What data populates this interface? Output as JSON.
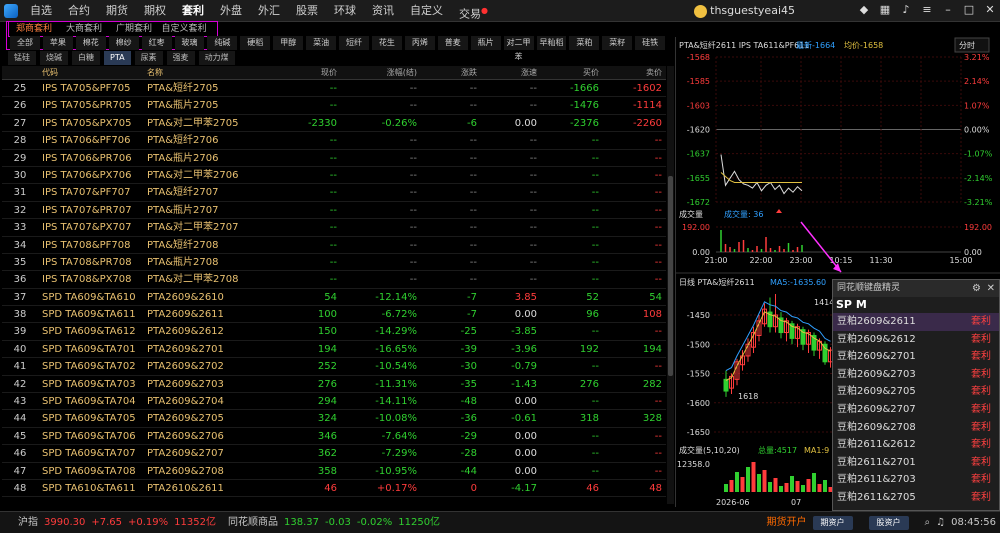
{
  "nav": {
    "items": [
      "自选",
      "合约",
      "期货",
      "期权",
      "套利",
      "外盘",
      "外汇",
      "股票",
      "环球",
      "资讯",
      "自定义",
      "交易"
    ],
    "active": "套利",
    "user": "thsguestyeai45"
  },
  "market_tabs": [
    "郑商套利",
    "大商套利",
    "广期套利",
    "自定义套利"
  ],
  "tool_buttons": [
    "全部",
    "苹果",
    "棉花",
    "棉纱",
    "红枣",
    "玻璃",
    "纯碱",
    "硬稻",
    "甲醇",
    "菜油",
    "短纤",
    "花生",
    "丙烯",
    "普麦",
    "瓶片",
    "对二甲苯",
    "早籼稻",
    "菜粕",
    "菜籽",
    "硅铁"
  ],
  "filter_tabs": [
    "锰硅",
    "烧碱",
    "白糖",
    "PTA",
    "尿素",
    "强麦",
    "动力煤"
  ],
  "filter_active": "PTA",
  "table": {
    "headers": [
      "",
      "代码",
      "名称",
      "现价",
      "涨幅(结)",
      "涨跌",
      "涨速",
      "买价",
      "卖价"
    ],
    "rows": [
      [
        "25",
        "IPS TA705&PF705",
        "PTA&短纤2705",
        "--",
        "--",
        "--",
        "--",
        "-1666",
        "-1602"
      ],
      [
        "26",
        "IPS TA705&PR705",
        "PTA&瓶片2705",
        "--",
        "--",
        "--",
        "--",
        "-1476",
        "-1114"
      ],
      [
        "27",
        "IPS TA705&PX705",
        "PTA&对二甲苯2705",
        "-2330",
        "-0.26%",
        "-6",
        "0.00",
        "-2376",
        "-2260"
      ],
      [
        "28",
        "IPS TA706&PF706",
        "PTA&短纤2706",
        "--",
        "--",
        "--",
        "--",
        "--",
        "--"
      ],
      [
        "29",
        "IPS TA706&PR706",
        "PTA&瓶片2706",
        "--",
        "--",
        "--",
        "--",
        "--",
        "--"
      ],
      [
        "30",
        "IPS TA706&PX706",
        "PTA&对二甲苯2706",
        "--",
        "--",
        "--",
        "--",
        "--",
        "--"
      ],
      [
        "31",
        "IPS TA707&PF707",
        "PTA&短纤2707",
        "--",
        "--",
        "--",
        "--",
        "--",
        "--"
      ],
      [
        "32",
        "IPS TA707&PR707",
        "PTA&瓶片2707",
        "--",
        "--",
        "--",
        "--",
        "--",
        "--"
      ],
      [
        "33",
        "IPS TA707&PX707",
        "PTA&对二甲苯2707",
        "--",
        "--",
        "--",
        "--",
        "--",
        "--"
      ],
      [
        "34",
        "IPS TA708&PF708",
        "PTA&短纤2708",
        "--",
        "--",
        "--",
        "--",
        "--",
        "--"
      ],
      [
        "35",
        "IPS TA708&PR708",
        "PTA&瓶片2708",
        "--",
        "--",
        "--",
        "--",
        "--",
        "--"
      ],
      [
        "36",
        "IPS TA708&PX708",
        "PTA&对二甲苯2708",
        "--",
        "--",
        "--",
        "--",
        "--",
        "--"
      ],
      [
        "37",
        "SPD TA609&TA610",
        "PTA2609&2610",
        "54",
        "-12.14%",
        "-7",
        "3.85",
        "52",
        "54"
      ],
      [
        "38",
        "SPD TA609&TA611",
        "PTA2609&2611",
        "100",
        "-6.72%",
        "-7",
        "0.00",
        "96",
        "108"
      ],
      [
        "39",
        "SPD TA609&TA612",
        "PTA2609&2612",
        "150",
        "-14.29%",
        "-25",
        "-3.85",
        "--",
        "--"
      ],
      [
        "40",
        "SPD TA609&TA701",
        "PTA2609&2701",
        "194",
        "-16.65%",
        "-39",
        "-3.96",
        "192",
        "194"
      ],
      [
        "41",
        "SPD TA609&TA702",
        "PTA2609&2702",
        "252",
        "-10.54%",
        "-30",
        "-0.79",
        "--",
        "--"
      ],
      [
        "42",
        "SPD TA609&TA703",
        "PTA2609&2703",
        "276",
        "-11.31%",
        "-35",
        "-1.43",
        "276",
        "282"
      ],
      [
        "43",
        "SPD TA609&TA704",
        "PTA2609&2704",
        "294",
        "-14.11%",
        "-48",
        "0.00",
        "--",
        "--"
      ],
      [
        "44",
        "SPD TA609&TA705",
        "PTA2609&2705",
        "324",
        "-10.08%",
        "-36",
        "-0.61",
        "318",
        "328"
      ],
      [
        "45",
        "SPD TA609&TA706",
        "PTA2609&2706",
        "346",
        "-7.64%",
        "-29",
        "0.00",
        "--",
        "--"
      ],
      [
        "46",
        "SPD TA609&TA707",
        "PTA2609&2707",
        "362",
        "-7.29%",
        "-28",
        "0.00",
        "--",
        "--"
      ],
      [
        "47",
        "SPD TA609&TA708",
        "PTA2609&2708",
        "358",
        "-10.95%",
        "-44",
        "0.00",
        "--",
        "--"
      ],
      [
        "48",
        "SPD TA610&TA611",
        "PTA2610&2611",
        "46",
        "+0.17%",
        "0",
        "-4.17",
        "46",
        "48"
      ]
    ]
  },
  "minute_chart": {
    "title": "PTA&短纤2611  IPS TA611&PF611",
    "latest_label": "最新-1664",
    "avg_label": "均价-1658",
    "mode": "分时",
    "yticks": [
      "-1568",
      "-1585",
      "-1603",
      "-1620",
      "-1637",
      "-1655",
      "-1672"
    ],
    "pct_ticks": [
      "3.21%",
      "2.14%",
      "1.07%",
      "0.00%",
      "-1.07%",
      "-2.14%",
      "-3.21%"
    ],
    "volume_label": "成交量",
    "volume_value": "成交量: 36",
    "vol_ticks": [
      "192.00",
      "0.00"
    ],
    "times": [
      "21:00",
      "22:00",
      "23:00",
      "10:15",
      "11:30",
      "15:00"
    ]
  },
  "kline_chart": {
    "title": "日线 PTA&短纤2611",
    "ma_label": "MA5:-1635.60",
    "high_label": "1414",
    "low_label": "1618",
    "yticks": [
      "-1450",
      "-1500",
      "-1550",
      "-1600",
      "-1650"
    ],
    "vol_label": "成交量(5,10,20)",
    "vol_total": "总量:4517",
    "vol_ma": "MA1:9",
    "vol_tick": "12358.0",
    "x_labels": [
      "2026-06",
      "07"
    ]
  },
  "sprite": {
    "title": "同花顺键盘精灵",
    "input": "SP M",
    "items": [
      {
        "name": "豆粕2609&2611",
        "tag": "套利"
      },
      {
        "name": "豆粕2609&2612",
        "tag": "套利"
      },
      {
        "name": "豆粕2609&2701",
        "tag": "套利"
      },
      {
        "name": "豆粕2609&2703",
        "tag": "套利"
      },
      {
        "name": "豆粕2609&2705",
        "tag": "套利"
      },
      {
        "name": "豆粕2609&2707",
        "tag": "套利"
      },
      {
        "name": "豆粕2609&2708",
        "tag": "套利"
      },
      {
        "name": "豆粕2611&2612",
        "tag": "套利"
      },
      {
        "name": "豆粕2611&2701",
        "tag": "套利"
      },
      {
        "name": "豆粕2611&2703",
        "tag": "套利"
      },
      {
        "name": "豆粕2611&2705",
        "tag": "套利"
      }
    ]
  },
  "status": {
    "idx1_name": "沪指",
    "idx1_val": "3990.30",
    "idx1_chg": "+7.65",
    "idx1_pct": "+0.19%",
    "idx1_amt": "11352亿",
    "idx2_name": "同花顺商品",
    "idx2_val": "138.37",
    "idx2_chg": "-0.03",
    "idx2_pct": "-0.02%",
    "idx2_amt": "11250亿",
    "open_account": "期货开户",
    "btn_sim": "期资户",
    "btn_real": "股资户",
    "time": "08:45:56"
  },
  "colors": {
    "up": "#ff3c3c",
    "down": "#30d030",
    "accent": "#d400d4"
  }
}
